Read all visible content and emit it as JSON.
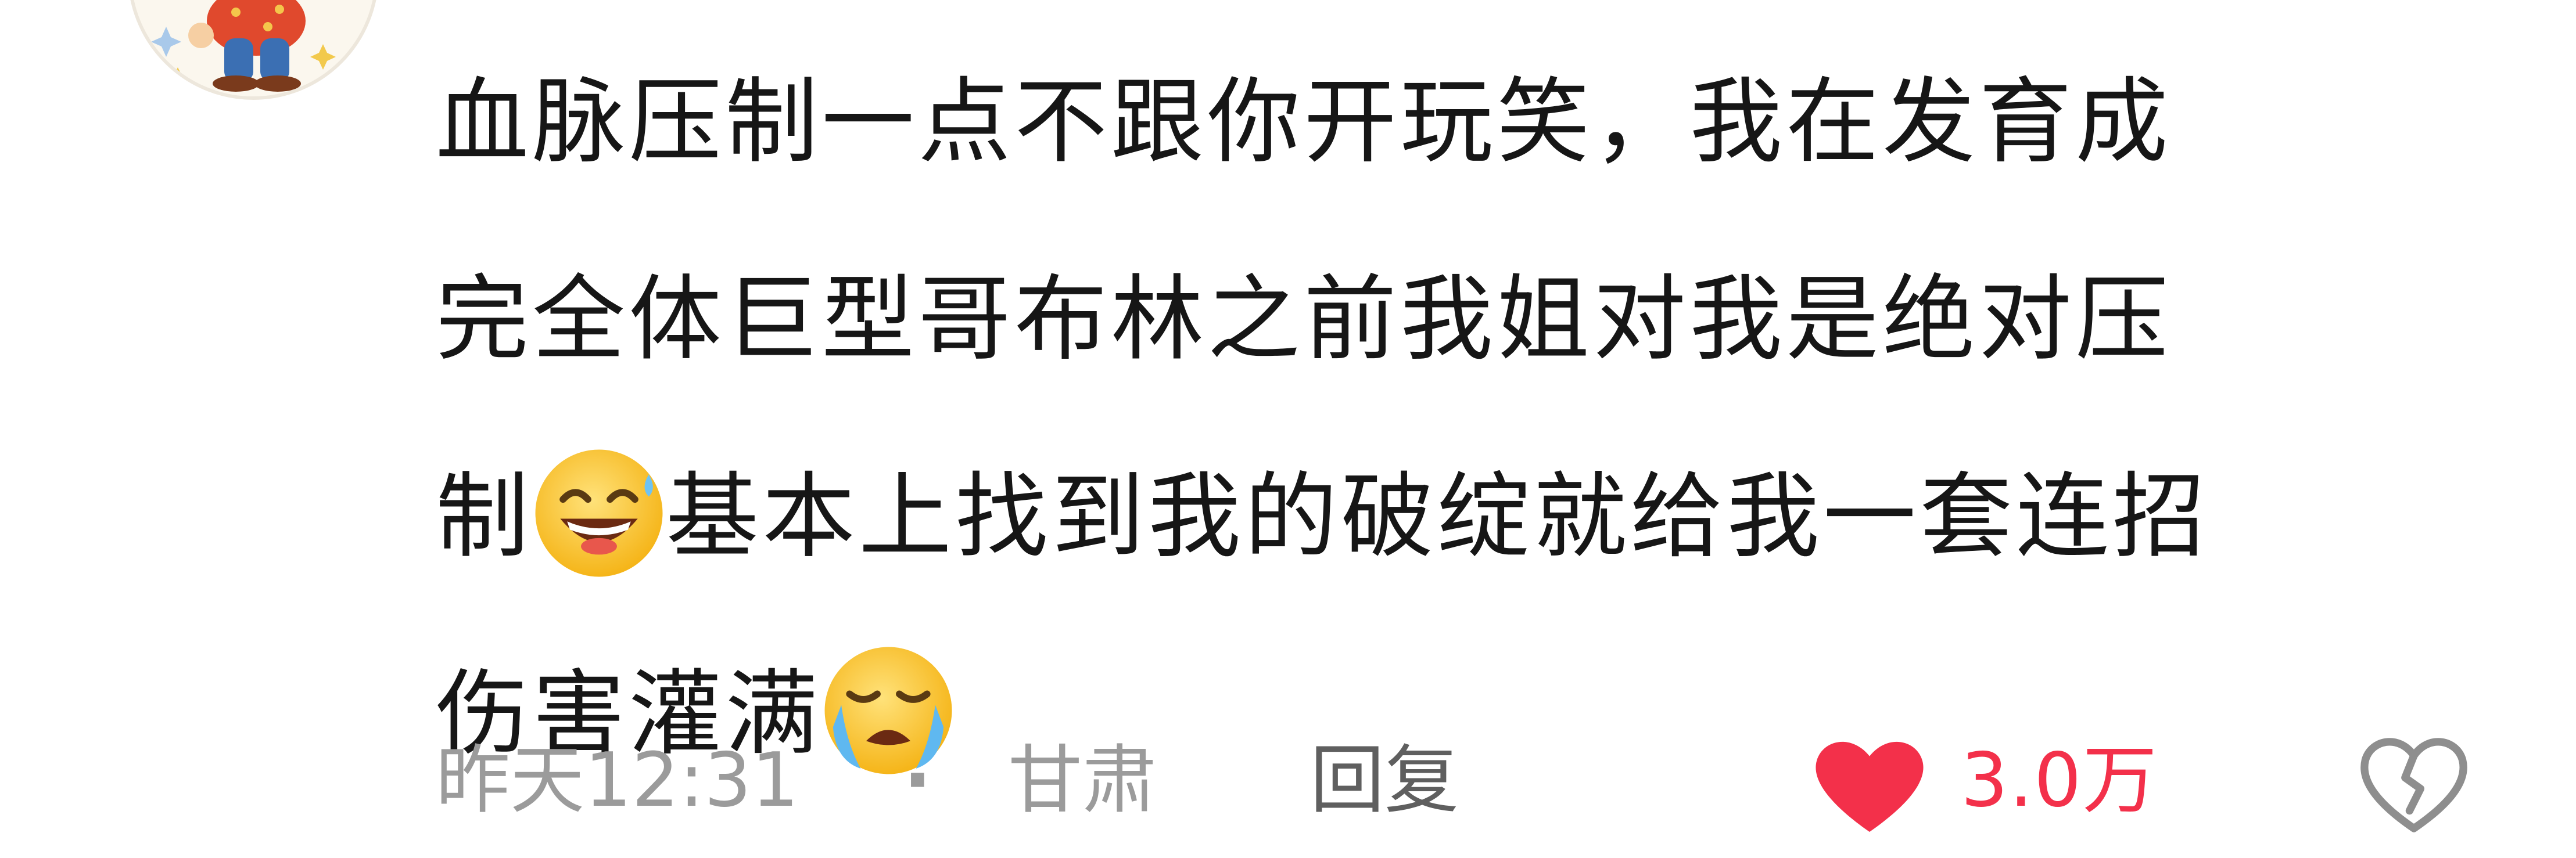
{
  "comment": {
    "lines": [
      "血脉压制一点不跟你开玩笑，我在发育成",
      "完全体巨型哥布林之前我姐对我是绝对压",
      "制",
      "基本上找到我的破绽就给我一套连招",
      "伤害灌满"
    ],
    "emojis": [
      "grinning-sweat-emoji",
      "crying-emoji"
    ]
  },
  "meta": {
    "time": "昨天12:31",
    "separator": "·",
    "location": "甘肃",
    "reply_label": "回复",
    "like_count": "3.0万"
  },
  "icons": {
    "like": "heart-icon",
    "dislike": "broken-heart-icon"
  },
  "colors": {
    "like_red": "#f3304a",
    "meta_gray": "#9b9b9b",
    "reply_gray": "#5f5f5f",
    "text": "#161616"
  }
}
